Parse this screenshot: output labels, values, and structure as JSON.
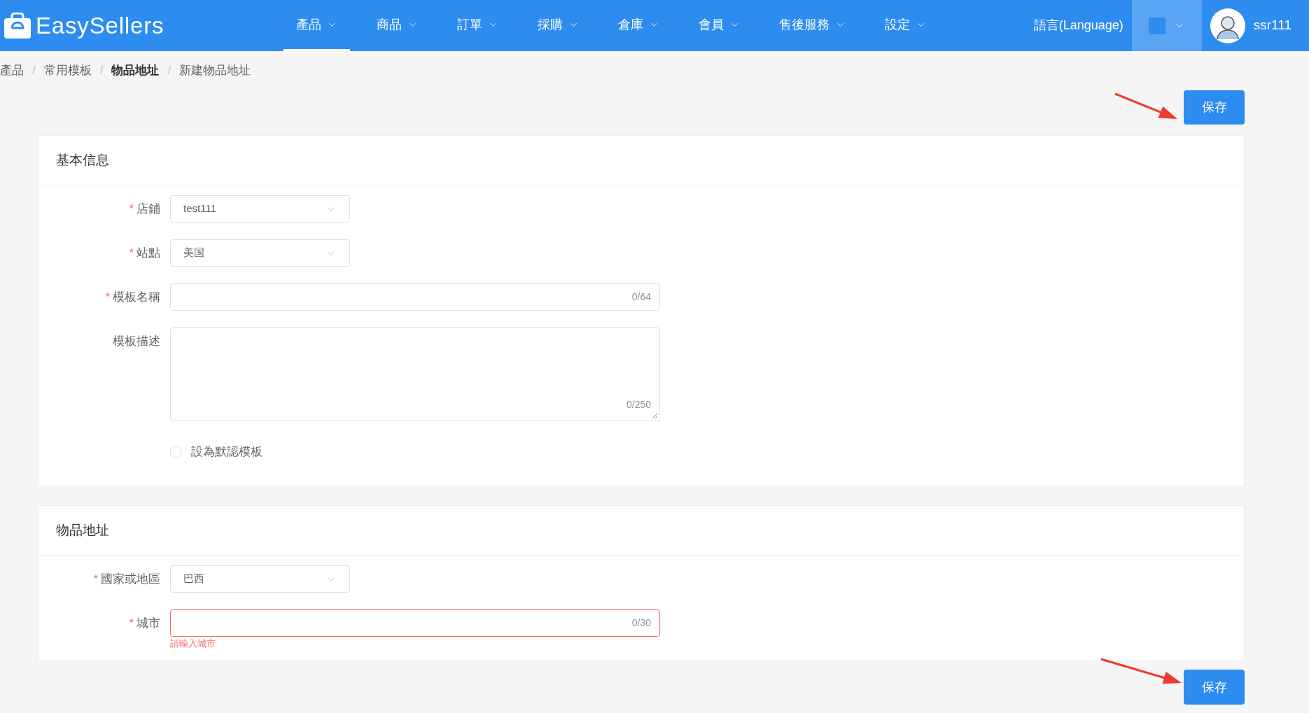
{
  "header": {
    "logo_text": "EasySellers",
    "nav": [
      {
        "label": "產品",
        "selected": true
      },
      {
        "label": "商品",
        "selected": false
      },
      {
        "label": "訂單",
        "selected": false
      },
      {
        "label": "採購",
        "selected": false
      },
      {
        "label": "倉庫",
        "selected": false
      },
      {
        "label": "會員",
        "selected": false
      },
      {
        "label": "售後服務",
        "selected": false
      },
      {
        "label": "設定",
        "selected": false
      }
    ],
    "language": "語言(Language)",
    "user": "ssr111"
  },
  "breadcrumb": [
    {
      "label": "產品",
      "bold": false
    },
    {
      "separator": "/",
      "label": "常用模板",
      "bold": false
    },
    {
      "separator": "/",
      "label": "物品地址",
      "bold": true
    },
    {
      "separator": "/",
      "label": "新建物品地址",
      "bold": false
    }
  ],
  "top_button": "保存",
  "sections": [
    {
      "title": "基本信息",
      "fields": [
        {
          "kind": "select",
          "required_mark": "*",
          "label": "店鋪",
          "value": "test111"
        },
        {
          "kind": "select",
          "required_mark": "*",
          "label": "站點",
          "value": "美国"
        },
        {
          "kind": "input",
          "required_mark": "*",
          "label": "模板名稱",
          "counter": "0/64"
        },
        {
          "kind": "textarea",
          "label": "模板描述",
          "counter": "0/250"
        },
        {
          "kind": "checkbox",
          "label": "設為默認模板",
          "checked": false
        }
      ]
    },
    {
      "title": "物品地址",
      "fields": [
        {
          "kind": "select",
          "required_mark": "*",
          "label": "國家或地區",
          "value": "巴西"
        },
        {
          "kind": "input",
          "required_mark": "*",
          "label": "城市",
          "counter": "0/30",
          "error": "請輸入城市"
        }
      ]
    }
  ],
  "bottom_button": "保存"
}
